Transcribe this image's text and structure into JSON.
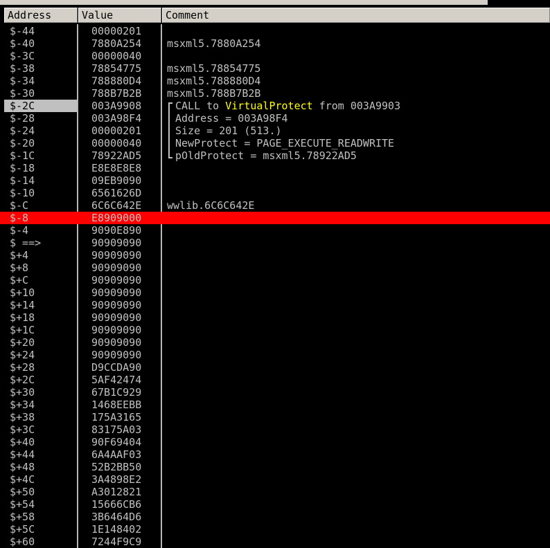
{
  "columns": {
    "address": "Address",
    "value": "Value",
    "comment": "Comment"
  },
  "rows": [
    {
      "address": "$-44",
      "value": "00000201",
      "comment": ""
    },
    {
      "address": "$-40",
      "value": "7880A254",
      "comment": "msxml5.7880A254"
    },
    {
      "address": "$-3C",
      "value": "00000040",
      "comment": ""
    },
    {
      "address": "$-38",
      "value": "78854775",
      "comment": "msxml5.78854775"
    },
    {
      "address": "$-34",
      "value": "788880D4",
      "comment": "msxml5.788880D4"
    },
    {
      "address": "$-30",
      "value": "788B7B2B",
      "comment": "msxml5.788B7B2B"
    },
    {
      "address": "$-2C",
      "value": "003A9908",
      "comment_parts": [
        "CALL to ",
        "VirtualProtect",
        " from 003A9903"
      ]
    },
    {
      "address": "$-28",
      "value": "003A98F4",
      "comment": "Address = 003A98F4"
    },
    {
      "address": "$-24",
      "value": "00000201",
      "comment": "Size = 201 (513.)"
    },
    {
      "address": "$-20",
      "value": "00000040",
      "comment": "NewProtect = PAGE_EXECUTE_READWRITE"
    },
    {
      "address": "$-1C",
      "value": "78922AD5",
      "comment": "pOldProtect = msxml5.78922AD5"
    },
    {
      "address": "$-18",
      "value": "E8E8E8E8",
      "comment": ""
    },
    {
      "address": "$-14",
      "value": "09EB9090",
      "comment": ""
    },
    {
      "address": "$-10",
      "value": "6561626D",
      "comment": ""
    },
    {
      "address": "$-C",
      "value": "6C6C642E",
      "comment": "wwlib.6C6C642E"
    },
    {
      "address": "$-8",
      "value": "E8909000",
      "comment": ""
    },
    {
      "address": "$-4",
      "value": "9090E890",
      "comment": ""
    },
    {
      "address": "$ ==>",
      "value": "90909090",
      "comment": ""
    },
    {
      "address": "$+4",
      "value": "90909090",
      "comment": ""
    },
    {
      "address": "$+8",
      "value": "90909090",
      "comment": ""
    },
    {
      "address": "$+C",
      "value": "90909090",
      "comment": ""
    },
    {
      "address": "$+10",
      "value": "90909090",
      "comment": ""
    },
    {
      "address": "$+14",
      "value": "90909090",
      "comment": ""
    },
    {
      "address": "$+18",
      "value": "90909090",
      "comment": ""
    },
    {
      "address": "$+1C",
      "value": "90909090",
      "comment": ""
    },
    {
      "address": "$+20",
      "value": "90909090",
      "comment": ""
    },
    {
      "address": "$+24",
      "value": "90909090",
      "comment": ""
    },
    {
      "address": "$+28",
      "value": "D9CCDA90",
      "comment": ""
    },
    {
      "address": "$+2C",
      "value": "5AF42474",
      "comment": ""
    },
    {
      "address": "$+30",
      "value": "67B1C929",
      "comment": ""
    },
    {
      "address": "$+34",
      "value": "1468EEBB",
      "comment": ""
    },
    {
      "address": "$+38",
      "value": "175A3165",
      "comment": ""
    },
    {
      "address": "$+3C",
      "value": "83175A03",
      "comment": ""
    },
    {
      "address": "$+40",
      "value": "90F69404",
      "comment": ""
    },
    {
      "address": "$+44",
      "value": "6A4AAF03",
      "comment": ""
    },
    {
      "address": "$+48",
      "value": "52B2BB50",
      "comment": ""
    },
    {
      "address": "$+4C",
      "value": "3A4898E2",
      "comment": ""
    },
    {
      "address": "$+50",
      "value": "A3012821",
      "comment": ""
    },
    {
      "address": "$+54",
      "value": "15666CB6",
      "comment": ""
    },
    {
      "address": "$+58",
      "value": "3B6464D6",
      "comment": ""
    },
    {
      "address": "$+5C",
      "value": "1E148402",
      "comment": ""
    },
    {
      "address": "$+60",
      "value": "7244F9C9",
      "comment": ""
    }
  ],
  "colors": {
    "background": "#000000",
    "text": "#c0c0c0",
    "highlight_row": "#ff0000",
    "api_name": "#ffff00",
    "header": "#d4d0c8"
  }
}
